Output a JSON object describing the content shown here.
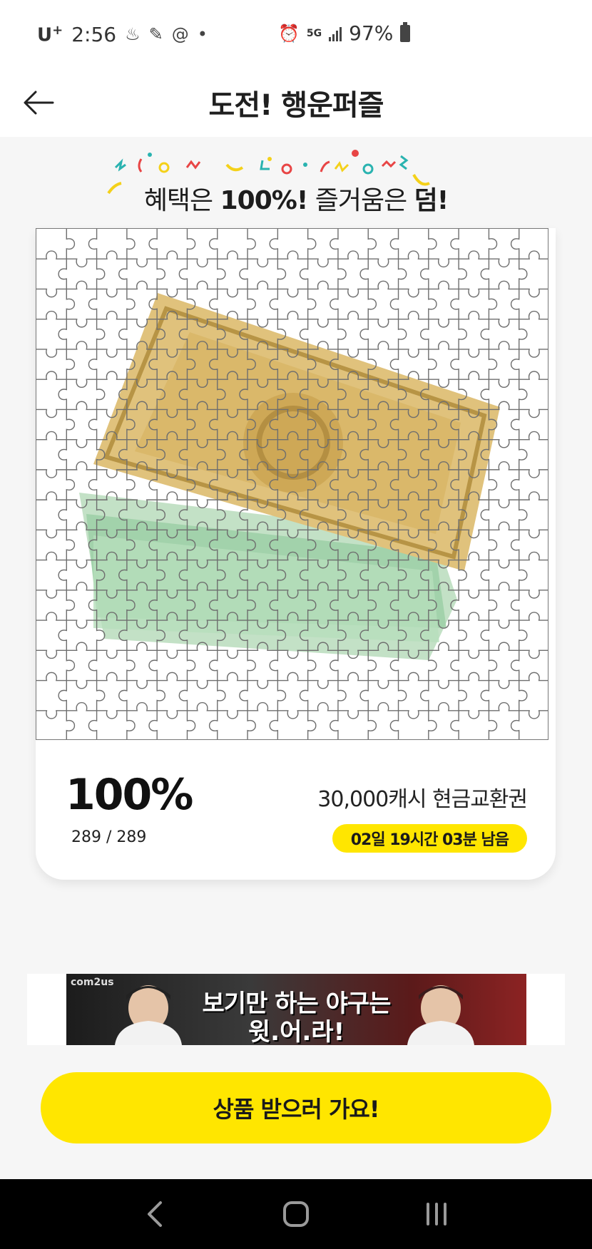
{
  "status_bar": {
    "carrier": "U",
    "carrier_sup": "+",
    "time": "2:56",
    "network": "5G",
    "battery": "97%"
  },
  "header": {
    "title": "도전! 행운퍼즐"
  },
  "banner": {
    "part1": "혜택은 ",
    "part2": "100%!",
    "part3": " 즐거움은 ",
    "part4": "덤!"
  },
  "puzzle": {
    "columns": 17,
    "rows": 17,
    "completed_pieces": 289,
    "total_pieces": 289
  },
  "progress": {
    "percent_label": "100%",
    "count_label": "289 / 289"
  },
  "prize": {
    "name": "30,000캐시 현금교환권",
    "time_remaining": "02일 19시간 03분 남음"
  },
  "ad": {
    "brand": "com2us",
    "line1": "보기만 하는 야구는",
    "line2": "윗.어.라!"
  },
  "cta": {
    "label": "상품 받으러 가요!"
  },
  "colors": {
    "accent": "#ffe600",
    "background": "#f6f6f6"
  }
}
